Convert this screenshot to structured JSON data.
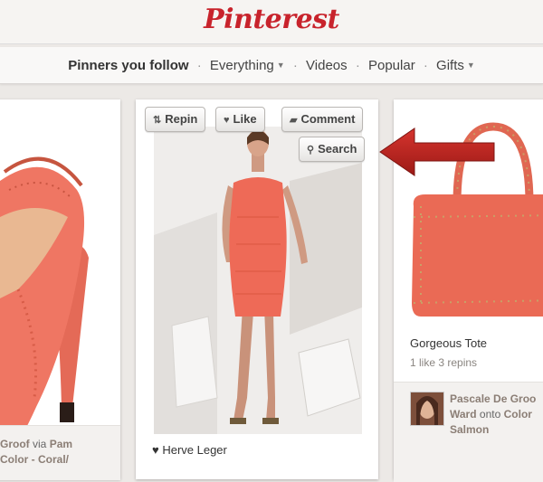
{
  "header": {
    "logo": "Pinterest"
  },
  "nav": {
    "items": [
      {
        "label": "Pinners you follow",
        "active": true,
        "dropdown": false
      },
      {
        "label": "Everything",
        "dropdown": true
      },
      {
        "label": "Videos",
        "dropdown": false
      },
      {
        "label": "Popular",
        "dropdown": false
      },
      {
        "label": "Gifts",
        "dropdown": true
      }
    ]
  },
  "left_pin": {
    "footer_name": "Groof",
    "footer_via": "via",
    "footer_user": "Pam",
    "footer_board": "Color - Coral/"
  },
  "center_pin": {
    "actions": {
      "repin": "Repin",
      "like": "Like",
      "comment": "Comment",
      "search": "Search"
    },
    "caption": "♥ Herve Leger"
  },
  "right_pin": {
    "title": "Gorgeous Tote",
    "stats": "1 like  3 repins",
    "repinner": "Pascale De Groo",
    "repinner_rest": "Ward",
    "onto": "onto",
    "board": "Color",
    "board_rest": "Salmon"
  },
  "colors": {
    "accent": "#c8232c",
    "coral": "#ef6e5b"
  },
  "icons": [
    "repin-icon",
    "heart-icon",
    "comment-icon",
    "magnifier-icon",
    "arrow-icon"
  ]
}
